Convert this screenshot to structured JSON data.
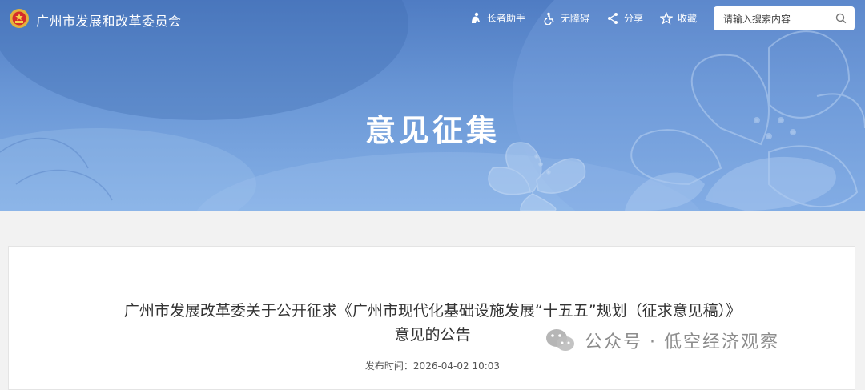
{
  "header": {
    "site_title": "广州市发展和改革委员会",
    "tools": [
      {
        "label": "长者助手",
        "icon": "elder-assist-icon"
      },
      {
        "label": "无障碍",
        "icon": "accessibility-icon"
      },
      {
        "label": "分享",
        "icon": "share-icon"
      },
      {
        "label": "收藏",
        "icon": "star-icon"
      }
    ],
    "search": {
      "placeholder": "请输入搜索内容",
      "icon": "search-icon"
    }
  },
  "banner": {
    "title": "意见征集"
  },
  "article": {
    "title_line1": "广州市发展改革委关于公开征求《广州市现代化基础设施发展“十五五”规划（征求意见稿）》",
    "title_line2": "意见的公告",
    "publish_time": "发布时间：2026-04-02 10:03"
  },
  "watermark": {
    "text": "公众号 · 低空经济观察",
    "icon": "wechat-icon"
  },
  "colors": {
    "banner_top": "#4f7cc3",
    "banner_bottom": "#85b0e6",
    "text": "#333333"
  }
}
